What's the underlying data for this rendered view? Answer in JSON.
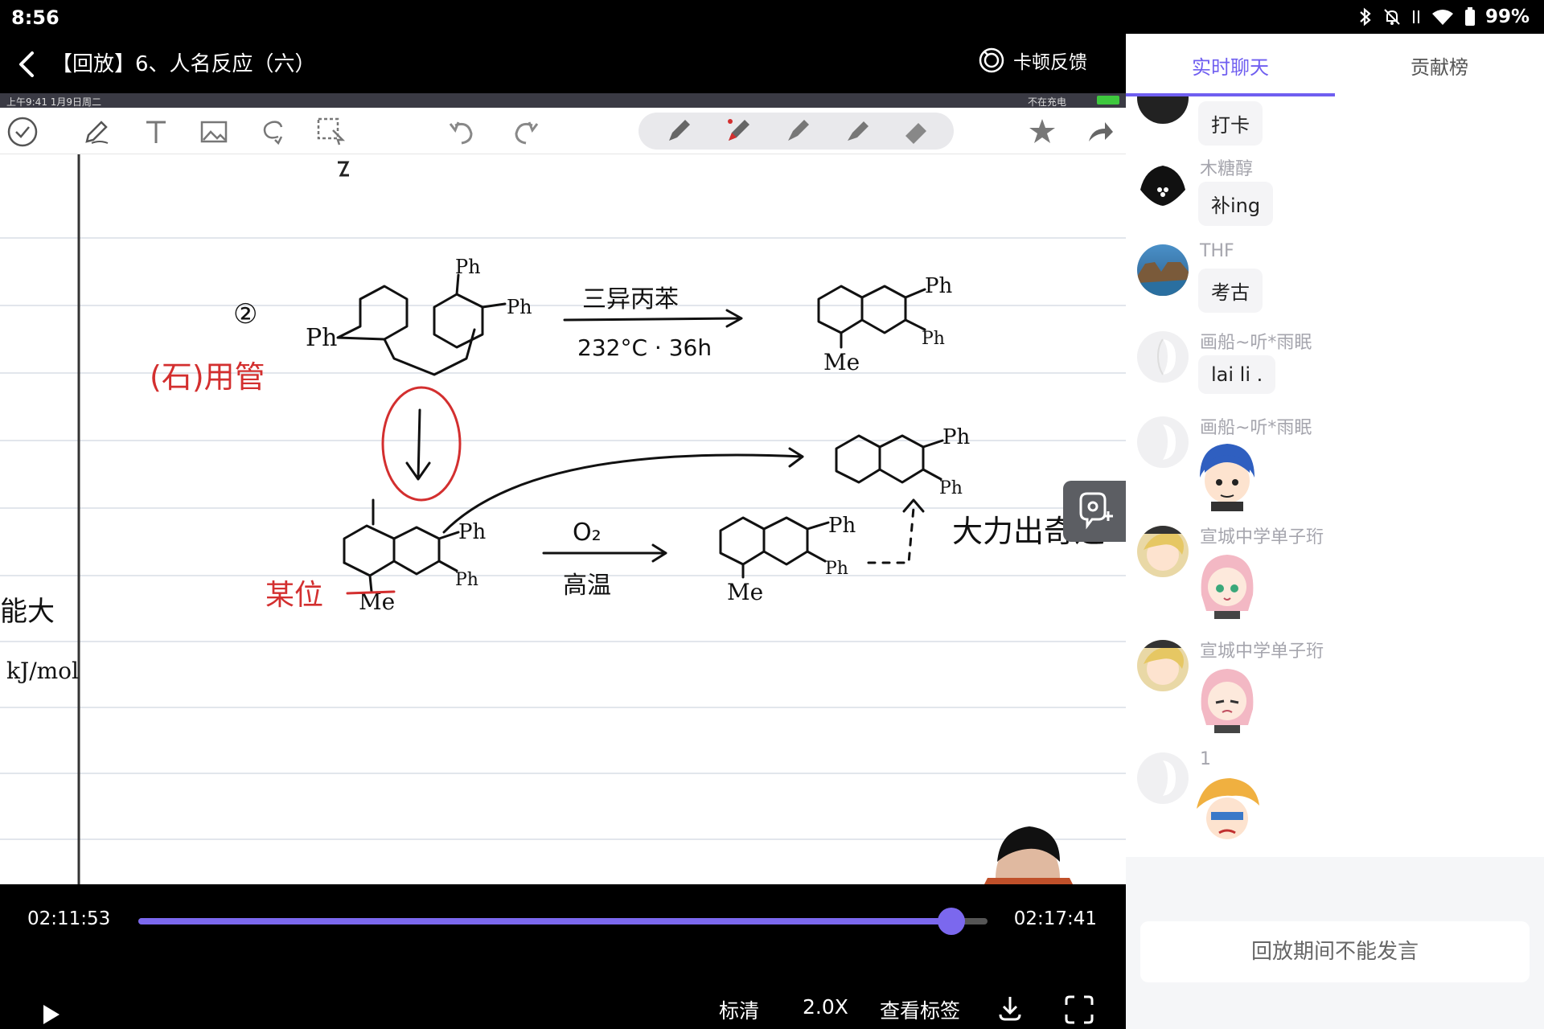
{
  "status_bar": {
    "time": "8:56",
    "battery": "99%"
  },
  "video": {
    "title": "【回放】6、人名反应（六）",
    "stutter_feedback": "卡顿反馈",
    "ipad_status_left": "上午9:41  1月9日周二",
    "ipad_status_right": "不在充电",
    "notes": {
      "circled_2": "②",
      "left_red_note": "(石)用管",
      "ph": "Ph",
      "me": "Me",
      "reagent_1_top": "三异丙苯",
      "reagent_1_bottom": "232°C · 36h",
      "reagent_2_top": "O₂",
      "reagent_2_bottom": "高温",
      "red_note_bottom": "某位",
      "side_note": "大力出奇迹",
      "left_edge_1": "能大",
      "left_edge_2": "kJ/mol"
    }
  },
  "controls": {
    "current_time": "02:11:53",
    "total_time": "02:17:41",
    "progress": 0.957,
    "quality": "标清",
    "speed": "2.0X",
    "view_tags": "查看标签"
  },
  "sidebar": {
    "tabs": [
      {
        "label": "实时聊天",
        "active": true
      },
      {
        "label": "贡献榜",
        "active": false
      }
    ],
    "messages": [
      {
        "user": "",
        "text": "打卡"
      },
      {
        "user": "木糖醇",
        "text": "补ing"
      },
      {
        "user": "THF",
        "text": "考古"
      },
      {
        "user": "画船~听*雨眠",
        "text": "lai li ."
      },
      {
        "user": "画船~听*雨眠",
        "sticker": "blue-hair-boy-sticker"
      },
      {
        "user": "宣城中学单子珩",
        "sticker": "pink-hair-girl-sticker"
      },
      {
        "user": "宣城中学单子珩",
        "sticker": "pink-hair-girl-sticker"
      },
      {
        "user": "1",
        "sticker": "blonde-boy-sticker"
      }
    ],
    "input_disabled_text": "回放期间不能发言"
  },
  "colors": {
    "accent": "#7b68ee",
    "tab_accent": "#6f5ef0",
    "red_ink": "#d32f2f"
  }
}
